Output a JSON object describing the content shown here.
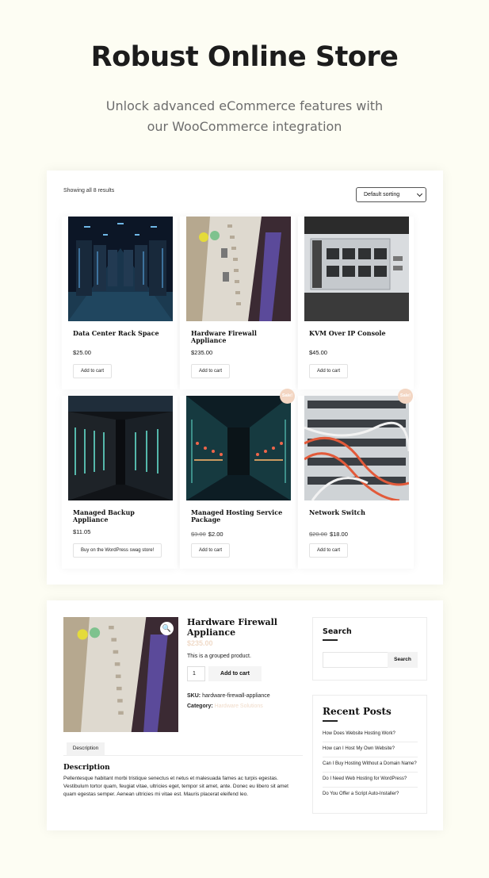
{
  "hero": {
    "title": "Robust Online Store",
    "subtitle_line1": "Unlock advanced eCommerce features with",
    "subtitle_line2": "our WooCommerce integration"
  },
  "shop": {
    "results_text": "Showing all 8 results",
    "sorting_value": "Default sorting",
    "products": [
      {
        "name": "Data Center Rack Space",
        "price": "$25.00",
        "button": "Add to cart",
        "image": "server-aisle"
      },
      {
        "name": "Hardware Firewall Appliance",
        "price": "$235.00",
        "button": "Add to cart",
        "image": "firewall-board"
      },
      {
        "name": "KVM Over IP Console",
        "price": "$45.00",
        "button": "Add to cart",
        "image": "poe-ports"
      },
      {
        "name": "Managed Backup Appliance",
        "price": "$11.05",
        "button": "Buy on the WordPress swag store!",
        "image": "server-racks"
      },
      {
        "name": "Managed Hosting Service Package",
        "old_price": "$3.00",
        "price": "$2.00",
        "button": "Add to cart",
        "sale": "Sale!",
        "image": "hosting-aisle"
      },
      {
        "name": "Network Switch",
        "old_price": "$20.00",
        "price": "$18.00",
        "button": "Add to cart",
        "sale": "Sale!",
        "image": "network-switch"
      }
    ]
  },
  "single": {
    "title": "Hardware Firewall Appliance",
    "price": "$235.00",
    "short_desc": "This is a grouped product.",
    "qty": "1",
    "add_button": "Add to cart",
    "sku_label": "SKU:",
    "sku_value": "hardware-firewall-appliance",
    "category_label": "Category:",
    "category_value": "Hardware Solutions",
    "tab_label": "Description",
    "desc_heading": "Description",
    "desc_text": "Pellentesque habitant morbi tristique senectus et netus et malesuada fames ac turpis egestas. Vestibulum tortor quam, feugiat vitae, ultricies eget, tempor sit amet, ante. Donec eu libero sit amet quam egestas semper. Aenean ultricies mi vitae est. Mauris placerat eleifend leo.",
    "zoom_icon": "magnifier-icon"
  },
  "sidebar": {
    "search_title": "Search",
    "search_button": "Search",
    "search_value": "",
    "recent_title": "Recent Posts",
    "posts": [
      "How Does Website Hosting Work?",
      "How can I Host My Own Website?",
      "Can I Buy Hosting Without a Domain Name?",
      "Do I Need Web Hosting for WordPress?",
      "Do You Offer a Script Auto-Installer?"
    ]
  },
  "colors": {
    "background": "#fdfdf3",
    "sale_badge": "#f3d6c3",
    "accent_link": "#f0dbc9"
  }
}
